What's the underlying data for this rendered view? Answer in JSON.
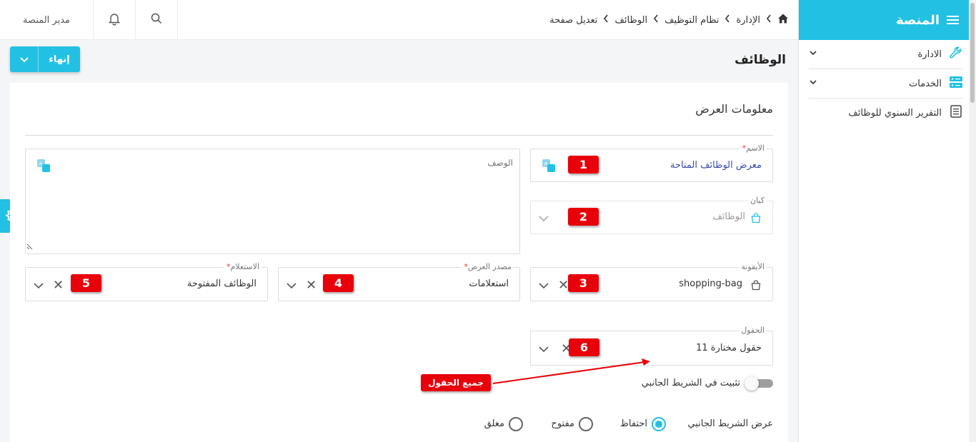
{
  "sidebar": {
    "brand": "المنصة",
    "items": [
      {
        "label": "الادارة",
        "icon": "wrench-icon",
        "expandable": true
      },
      {
        "label": "الخدمات",
        "icon": "server-icon",
        "expandable": true
      },
      {
        "label": "التقرير السنوي للوظائف",
        "icon": "document-icon",
        "expandable": false
      }
    ]
  },
  "topbar": {
    "user": "مدير المنصة",
    "breadcrumb": [
      "الإدارة",
      "نظام التوظيف",
      "الوظائف",
      "تعديل صفحة"
    ]
  },
  "page": {
    "title": "الوظائف",
    "finish_label": "إنهاء"
  },
  "form": {
    "section_title": "معلومات العرض",
    "name": {
      "label": "الاسم",
      "value": "معرض الوظائف المتاحة"
    },
    "description": {
      "label": "الوصف",
      "value": ""
    },
    "entity": {
      "label": "كيان",
      "value": "الوظائف"
    },
    "icon_field": {
      "label": "الأيقونة",
      "value": "shopping-bag"
    },
    "display_source": {
      "label": "مصدر العرض",
      "value": "استعلامات"
    },
    "query": {
      "label": "الاستعلام",
      "value": "الوظائف المفتوحة"
    },
    "fields": {
      "label": "الحقول",
      "value": "11 حقول مختارة"
    },
    "pin_sidebar": {
      "label": "تثبيت في الشريط الجانبي",
      "value": false
    },
    "sidebar_display": {
      "label": "عرض الشريط الجانبي",
      "options": [
        "احتفاظ",
        "مفتوح",
        "مغلق"
      ],
      "selected": "احتفاظ"
    }
  },
  "annotations": {
    "badges": [
      "1",
      "2",
      "3",
      "4",
      "5",
      "6"
    ],
    "note": "جميع الحقول"
  },
  "colors": {
    "accent": "#22c1e3",
    "annotation_red": "#e8000a",
    "required": "#e53935"
  }
}
